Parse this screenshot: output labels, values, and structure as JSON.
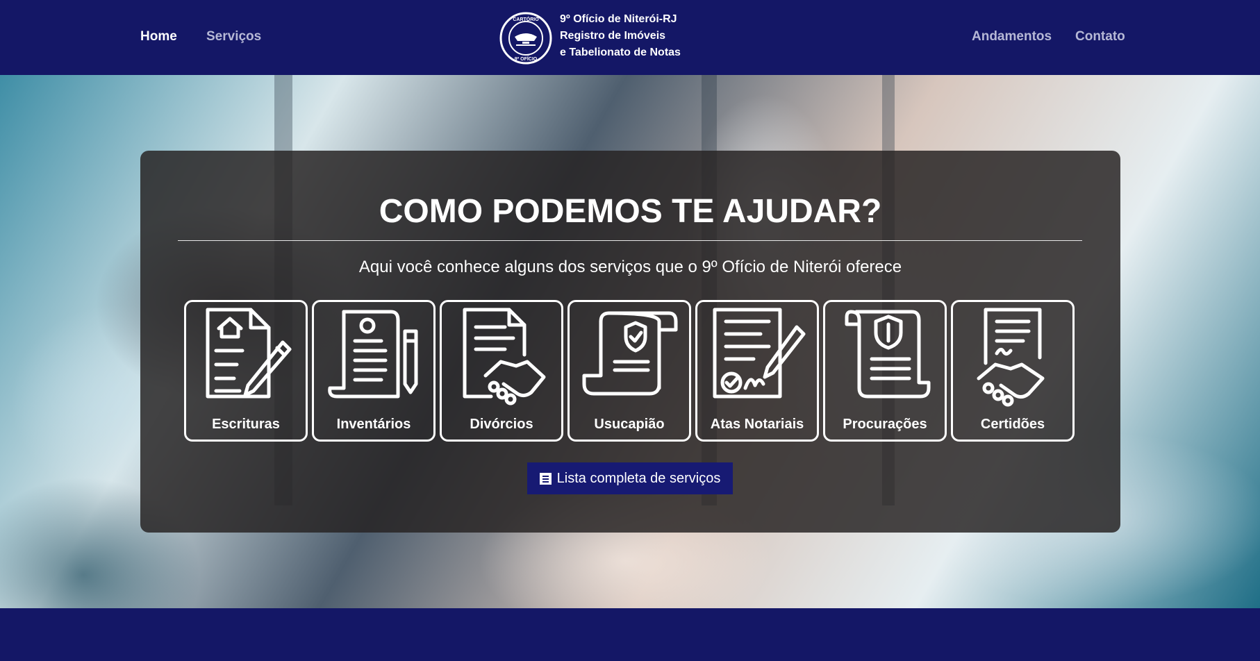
{
  "nav": {
    "home": "Home",
    "services": "Serviços",
    "progress": "Andamentos",
    "contact": "Contato"
  },
  "brand": {
    "lines": [
      "9º Ofício de Niterói-RJ",
      "Registro de Imóveis",
      "e Tabelionato de Notas"
    ],
    "logo_text": [
      "CARTÓRIO",
      "9º OFÍCIO"
    ]
  },
  "hero": {
    "title": "COMO PODEMOS TE AJUDAR?",
    "subtitle": "Aqui você conhece alguns dos serviços que o 9º Ofício de Niterói oferece",
    "services": [
      {
        "label": "Escrituras",
        "icon": "document-house-pen-icon"
      },
      {
        "label": "Inventários",
        "icon": "scroll-list-pen-icon"
      },
      {
        "label": "Divórcios",
        "icon": "document-handshake-icon"
      },
      {
        "label": "Usucapião",
        "icon": "scroll-shield-icon"
      },
      {
        "label": "Atas Notariais",
        "icon": "document-check-pen-icon"
      },
      {
        "label": "Procurações",
        "icon": "scroll-shield-lines-icon"
      },
      {
        "label": "Certidões",
        "icon": "document-signature-handshake-icon"
      }
    ],
    "list_button": "Lista completa de serviços",
    "list_icon": "list-icon"
  },
  "colors": {
    "navy": "#141766",
    "button": "#171a73",
    "panel": "rgba(38,35,35,0.84)"
  }
}
